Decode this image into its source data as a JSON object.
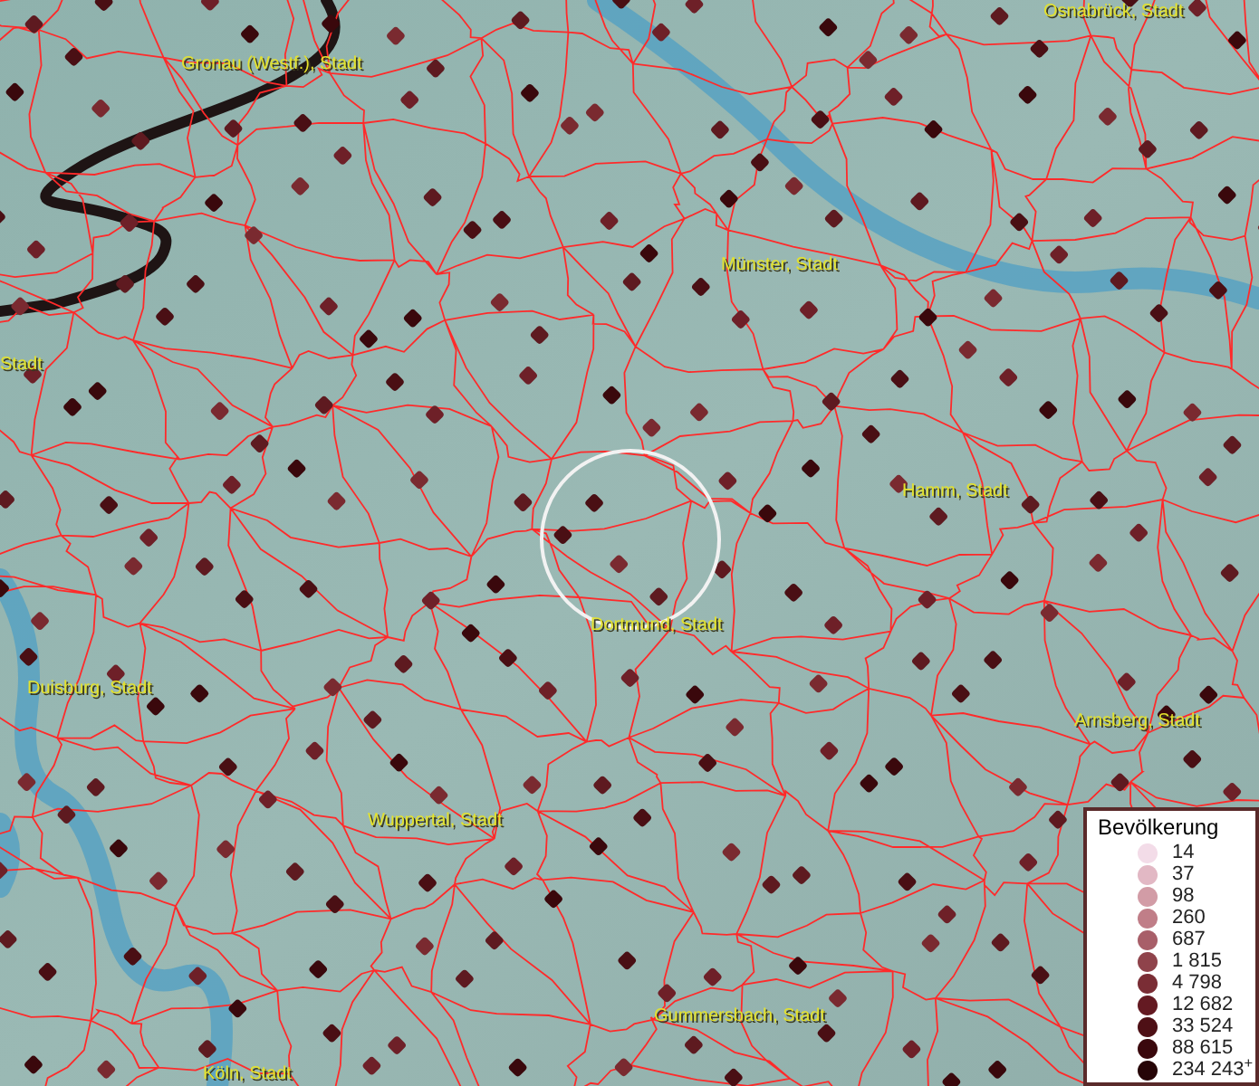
{
  "map": {
    "labels": [
      {
        "text": "Gronau (Westf.), Stadt"
      },
      {
        "text": "Osnabrück, Stadt"
      },
      {
        "text": "Münster, Stadt"
      },
      {
        "text": "Stadt"
      },
      {
        "text": "Hamm, Stadt"
      },
      {
        "text": "Dortmund, Stadt"
      },
      {
        "text": "Duisburg, Stadt"
      },
      {
        "text": "Arnsberg, Stadt"
      },
      {
        "text": "Wuppertal, Stadt"
      },
      {
        "text": "Gummersbach, Stadt"
      },
      {
        "text": "Köln, Stadt"
      }
    ]
  },
  "legend": {
    "title": "Bevölkerung",
    "items": [
      {
        "label": "14",
        "color": "#f3dce8"
      },
      {
        "label": "37",
        "color": "#e2b8c4"
      },
      {
        "label": "98",
        "color": "#d29ca6"
      },
      {
        "label": "260",
        "color": "#c07e88"
      },
      {
        "label": "687",
        "color": "#a85f69"
      },
      {
        "label": "1 815",
        "color": "#8f434b"
      },
      {
        "label": "4 798",
        "color": "#7a2d35"
      },
      {
        "label": "12 682",
        "color": "#641a22"
      },
      {
        "label": "33 524",
        "color": "#4e1016"
      },
      {
        "label": "88 615",
        "color": "#3a080d"
      },
      {
        "label": "234 243$^{+}$",
        "color": "#260507"
      }
    ]
  }
}
